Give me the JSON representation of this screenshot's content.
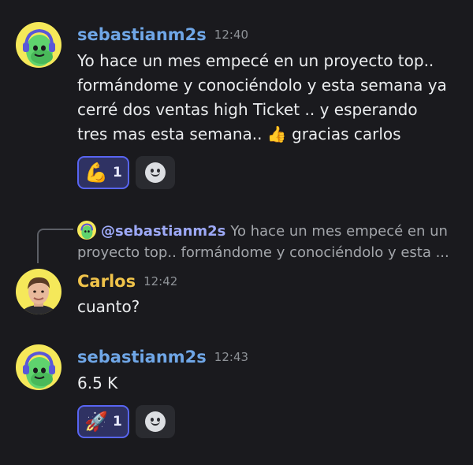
{
  "messages": [
    {
      "author": "sebastianm2s",
      "author_color": "#6fa6e6",
      "time": "12:40",
      "lines": [
        "Yo hace un mes empecé en un proyecto top..",
        "formándome y conociéndolo y esta semana ya",
        "cerré dos ventas high Ticket .. y esperando",
        "tres mas esta semana.. 👍 gracias carlos"
      ],
      "reaction": {
        "emoji": "💪",
        "count": "1"
      }
    },
    {
      "reply": {
        "mention": "@sebastianm2s",
        "line1": "Yo hace un mes empecé en un",
        "line2": "proyecto top.. formándome y conociéndolo y esta ..."
      },
      "author": "Carlos",
      "author_color": "#f0c34a",
      "time": "12:42",
      "text": "cuanto?"
    },
    {
      "author": "sebastianm2s",
      "author_color": "#6fa6e6",
      "time": "12:43",
      "text": "6.5 K",
      "reaction": {
        "emoji": "🚀",
        "count": "1"
      }
    }
  ]
}
